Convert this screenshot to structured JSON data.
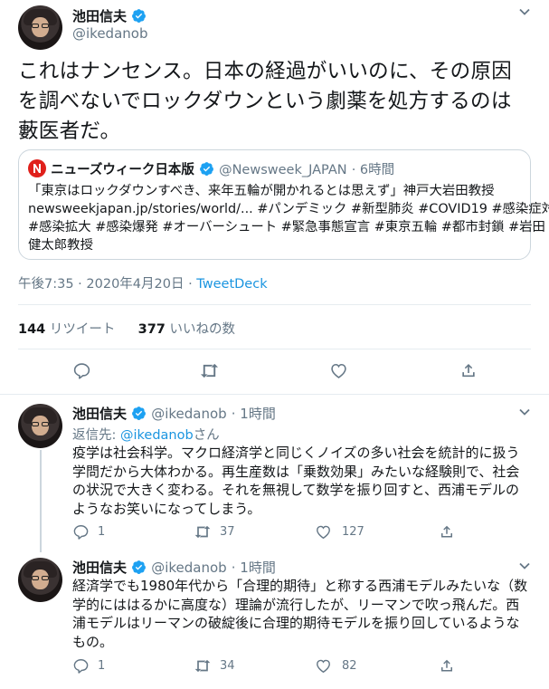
{
  "main_tweet": {
    "author_name": "池田信夫",
    "handle": "@ikedanob",
    "text_lines": [
      "これはナンセンス。日本の経過がいいのに、その原因",
      "を調べないでロックダウンという劇薬を処方するのは",
      "藪医者だ。"
    ],
    "quote": {
      "author_name": "ニューズウィーク日本版",
      "handle": "@Newsweek_JAPAN",
      "time": "· 6時間",
      "lines": [
        "「東京はロックダウンすべき、来年五輪が開かれるとは思えず」神戸大岩田教授",
        "newsweekjapan.jp/stories/world/... #パンデミック #新型肺炎 #COVID19 #感染症対策",
        "#感染拡大 #感染爆発 #オーバーシュート #緊急事態宣言 #東京五輪 #都市封鎖 #岩田",
        "健太郎教授"
      ]
    },
    "timestamp": "午後7:35 · 2020年4月20日 · ",
    "source": "TweetDeck",
    "retweets_count": "144",
    "retweets_label": "リツイート",
    "likes_count": "377",
    "likes_label": "いいねの数"
  },
  "replies": [
    {
      "author_name": "池田信夫",
      "handle": "@ikedanob",
      "time": "· 1時間",
      "reply_to_prefix": "返信先: ",
      "reply_to_handle": "@ikedanob",
      "reply_to_suffix": "さん",
      "lines": [
        "疫学は社会科学。マクロ経済学と同じくノイズの多い社会を統計的に扱う",
        "学問だから大体わかる。再生産数は「乗数効果」みたいな経験則で、社会",
        "の状況で大きく変わる。それを無視して数学を振り回すと、西浦モデルの",
        "ようなお笑いになってしまう。"
      ],
      "reply_count": "1",
      "retweet_count": "37",
      "like_count": "127"
    },
    {
      "author_name": "池田信夫",
      "handle": "@ikedanob",
      "time": "· 1時間",
      "lines": [
        "経済学でも1980年代から「合理的期待」と称する西浦モデルみたいな（数",
        "学的にははるかに高度な）理論が流行したが、リーマンで吹っ飛んだ。西",
        "浦モデルはリーマンの破綻後に合理的期待モデルを振り回しているような",
        "もの。"
      ],
      "reply_count": "1",
      "retweet_count": "34",
      "like_count": "82"
    }
  ],
  "colors": {
    "text": "#14171a",
    "secondary": "#657786",
    "link": "#1b95e0",
    "verified": "#1da1f2",
    "border": "#e6ecf0"
  },
  "icons": [
    "chevron-down-icon",
    "verified-icon",
    "reply-icon",
    "retweet-icon",
    "like-icon",
    "share-icon",
    "newsweek-logo"
  ]
}
